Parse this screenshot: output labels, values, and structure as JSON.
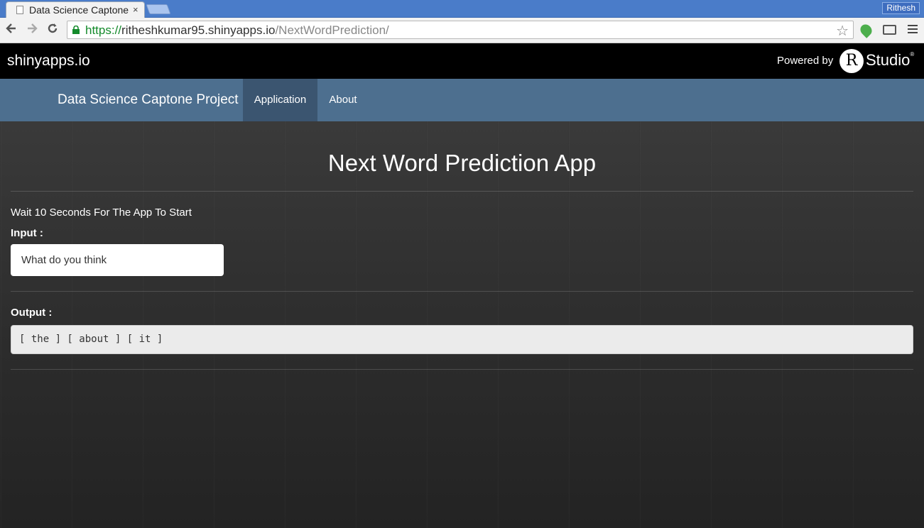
{
  "browser": {
    "tab_title": "Data Science Captone Project",
    "tab_close": "×",
    "profile": "Rithesh",
    "url_scheme": "https://",
    "url_host": "ritheshkumar95.shinyapps.io",
    "url_path": "/NextWordPrediction/"
  },
  "shinyapps": {
    "logo": "shinyapps.io",
    "powered_by": "Powered by",
    "rstudio_mark": "R",
    "rstudio_name": "Studio"
  },
  "navbar": {
    "brand": "Data Science Captone Project",
    "items": [
      {
        "label": "Application",
        "active": true
      },
      {
        "label": "About",
        "active": false
      }
    ]
  },
  "main": {
    "title": "Next Word Prediction App",
    "wait_message": "Wait 10 Seconds For The App To Start",
    "input_label": "Input :",
    "input_value": "What do you think",
    "output_label": "Output :",
    "output_value": "[ the ] [ about ] [ it ]"
  },
  "colors": {
    "navbar": "#4d6f8f",
    "navbar_active": "#3b5570",
    "shinybar": "#000000",
    "tabstrip": "#4a7cc9"
  }
}
